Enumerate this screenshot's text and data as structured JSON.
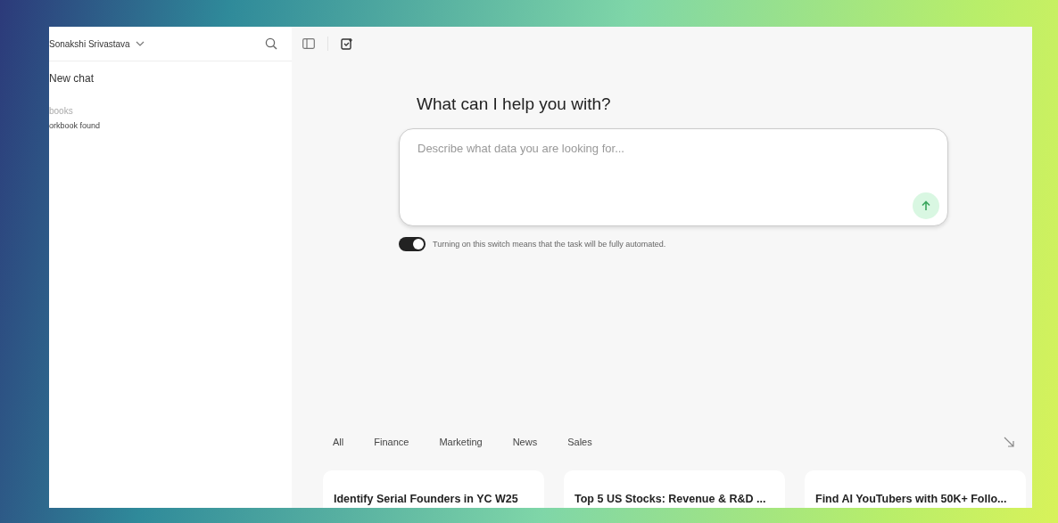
{
  "sidebar": {
    "user_name": "Sonakshi Srivastava",
    "new_chat": "New chat",
    "section_title": "books",
    "empty_message": "orkbook found"
  },
  "prompt": {
    "title": "What can I help you with?",
    "placeholder": "Describe what data you are looking for...",
    "automation": {
      "on": true,
      "label": "Turning on this switch means that the task will be fully automated."
    }
  },
  "categories": [
    {
      "label": "All",
      "selected": false
    },
    {
      "label": "Finance",
      "selected": false
    },
    {
      "label": "Marketing",
      "selected": false
    },
    {
      "label": "News",
      "selected": false
    },
    {
      "label": "Sales",
      "selected": false
    }
  ],
  "templates": [
    {
      "title": "Identify Serial Founders in YC W25"
    },
    {
      "title": "Top 5 US Stocks: Revenue & R&D ..."
    },
    {
      "title": "Find AI YouTubers with 50K+ Follo..."
    }
  ]
}
